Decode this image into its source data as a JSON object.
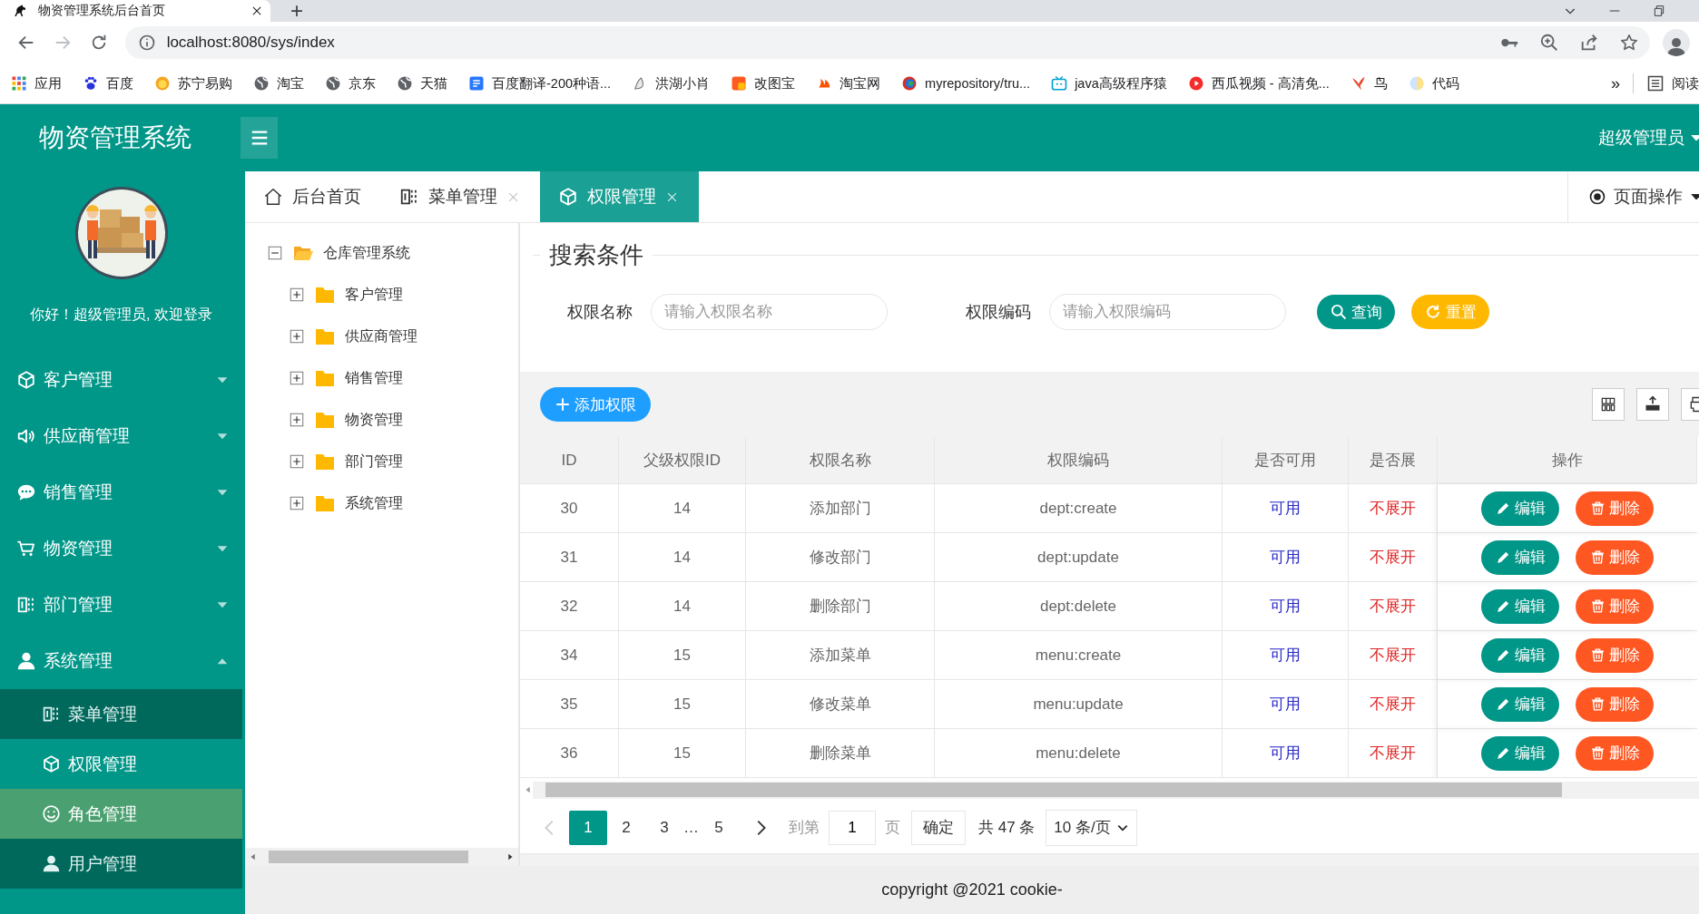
{
  "browser": {
    "tab_title": "物资管理系统后台首页",
    "new_tab": "+",
    "url": "localhost:8080/sys/index",
    "bookmarks": [
      {
        "label": "应用"
      },
      {
        "label": "百度"
      },
      {
        "label": "苏宁易购"
      },
      {
        "label": "淘宝"
      },
      {
        "label": "京东"
      },
      {
        "label": "天猫"
      },
      {
        "label": "百度翻译-200种语..."
      },
      {
        "label": "洪湖小肖"
      },
      {
        "label": "改图宝"
      },
      {
        "label": "淘宝网"
      },
      {
        "label": "myrepository/tru..."
      },
      {
        "label": "java高级程序猿"
      },
      {
        "label": "西瓜视频 - 高清免..."
      },
      {
        "label": "鸟"
      },
      {
        "label": "代码"
      }
    ],
    "more": "»",
    "reading_list": "阅读"
  },
  "app": {
    "logo": "物资管理系统",
    "user_menu": "超级管理员",
    "welcome": "你好！超级管理员, 欢迎登录"
  },
  "sidebar": {
    "items": [
      {
        "label": "客户管理",
        "expanded": false
      },
      {
        "label": "供应商管理",
        "expanded": false
      },
      {
        "label": "销售管理",
        "expanded": false
      },
      {
        "label": "物资管理",
        "expanded": false
      },
      {
        "label": "部门管理",
        "expanded": false
      },
      {
        "label": "系统管理",
        "expanded": true,
        "children": [
          {
            "label": "菜单管理",
            "selected": false,
            "hovered": false
          },
          {
            "label": "权限管理",
            "selected": true,
            "hovered": false
          },
          {
            "label": "角色管理",
            "selected": false,
            "hovered": true
          },
          {
            "label": "用户管理",
            "selected": false,
            "hovered": false
          }
        ]
      }
    ]
  },
  "tabs": [
    {
      "label": "后台首页",
      "closable": false,
      "selected": false
    },
    {
      "label": "菜单管理",
      "closable": true,
      "selected": false
    },
    {
      "label": "权限管理",
      "closable": true,
      "selected": true
    }
  ],
  "page_actions": "页面操作",
  "tree": {
    "label": "仓库管理系统",
    "expanded": true,
    "children": [
      {
        "label": "客户管理",
        "expanded": false
      },
      {
        "label": "供应商管理",
        "expanded": false
      },
      {
        "label": "销售管理",
        "expanded": false
      },
      {
        "label": "物资管理",
        "expanded": false
      },
      {
        "label": "部门管理",
        "expanded": false
      },
      {
        "label": "系统管理",
        "expanded": false
      }
    ]
  },
  "search": {
    "legend": "搜索条件",
    "fields": [
      {
        "label": "权限名称",
        "placeholder": "请输入权限名称"
      },
      {
        "label": "权限编码",
        "placeholder": "请输入权限编码"
      }
    ],
    "buttons": [
      {
        "label": "查询",
        "kind": "search"
      },
      {
        "label": "重置",
        "kind": "reset"
      }
    ]
  },
  "toolbar": {
    "add_button": "添加权限"
  },
  "table": {
    "columns": [
      "ID",
      "父级权限ID",
      "权限名称",
      "权限编码",
      "是否可用",
      "是否展",
      "操作"
    ],
    "rows": [
      {
        "id": "30",
        "parent_id": "14",
        "name": "添加部门",
        "code": "dept:create",
        "available": "可用",
        "expand": "不展开",
        "edit": "编辑",
        "delete": "删除"
      },
      {
        "id": "31",
        "parent_id": "14",
        "name": "修改部门",
        "code": "dept:update",
        "available": "可用",
        "expand": "不展开",
        "edit": "编辑",
        "delete": "删除"
      },
      {
        "id": "32",
        "parent_id": "14",
        "name": "删除部门",
        "code": "dept:delete",
        "available": "可用",
        "expand": "不展开",
        "edit": "编辑",
        "delete": "删除"
      },
      {
        "id": "34",
        "parent_id": "15",
        "name": "添加菜单",
        "code": "menu:create",
        "available": "可用",
        "expand": "不展开",
        "edit": "编辑",
        "delete": "删除"
      },
      {
        "id": "35",
        "parent_id": "15",
        "name": "修改菜单",
        "code": "menu:update",
        "available": "可用",
        "expand": "不展开",
        "edit": "编辑",
        "delete": "删除"
      },
      {
        "id": "36",
        "parent_id": "15",
        "name": "删除菜单",
        "code": "menu:delete",
        "available": "可用",
        "expand": "不展开",
        "edit": "编辑",
        "delete": "删除"
      }
    ]
  },
  "pagination": {
    "items": [
      {
        "label": "1",
        "kind": "page",
        "selected": true
      },
      {
        "label": "2",
        "kind": "page",
        "selected": false
      },
      {
        "label": "3",
        "kind": "page",
        "selected": false
      },
      {
        "label": "…",
        "kind": "ellipsis"
      },
      {
        "label": "5",
        "kind": "page",
        "selected": false
      }
    ],
    "goto_label": "到第",
    "goto_value": "1",
    "page_unit": "页",
    "confirm": "确定",
    "total": "共 47 条",
    "page_size": "10 条/页"
  },
  "footer": "copyright @2021 cookie-"
}
